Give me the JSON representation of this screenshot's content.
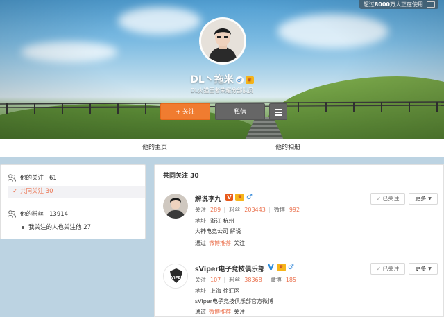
{
  "header": {
    "usage_text_pre": "超过",
    "usage_count": "8000",
    "usage_text_post": "万人正在使用",
    "name": "DL丶拖米",
    "bio": "DL火猫王者荣耀分部队员",
    "follow_label": "关注",
    "message_label": "私信",
    "follow_color": "#f07c30"
  },
  "tabs": [
    {
      "label": "他的主页"
    },
    {
      "label": "他的相册"
    }
  ],
  "sidebar": {
    "following": {
      "label": "他的关注",
      "count": "61"
    },
    "mutual": {
      "label": "共同关注",
      "count": "30"
    },
    "followers": {
      "label": "他的粉丝",
      "count": "13914"
    },
    "known": {
      "label": "我关注的人也关注他",
      "count": "27"
    }
  },
  "main": {
    "title": "共同关注 30",
    "users": [
      {
        "name": "解说李九",
        "verified": "orange",
        "following_label": "关注",
        "following": "289",
        "fans_label": "粉丝",
        "fans": "203443",
        "weibo_label": "微博",
        "weibo": "992",
        "location_label": "地址",
        "location": "浙江 杭州",
        "intro": "大神电竞公司 解说",
        "via_pre": "通过",
        "via_link": "微博推荐",
        "via_post": "关注",
        "followed_label": "已关注",
        "more_label": "更多"
      },
      {
        "name": "sViper电子竞技俱乐部",
        "verified": "blue",
        "following_label": "关注",
        "following": "107",
        "fans_label": "粉丝",
        "fans": "38368",
        "weibo_label": "微博",
        "weibo": "185",
        "location_label": "地址",
        "location": "上海 徐汇区",
        "intro": "sViper电子竞技俱乐部官方微博",
        "via_pre": "通过",
        "via_link": "微博推荐",
        "via_post": "关注",
        "followed_label": "已关注",
        "more_label": "更多",
        "logo_text": "sViPER"
      }
    ]
  },
  "colors": {
    "accent": "#eb7350",
    "vip": "#f6b41b",
    "blue_v": "#2b8bda"
  }
}
